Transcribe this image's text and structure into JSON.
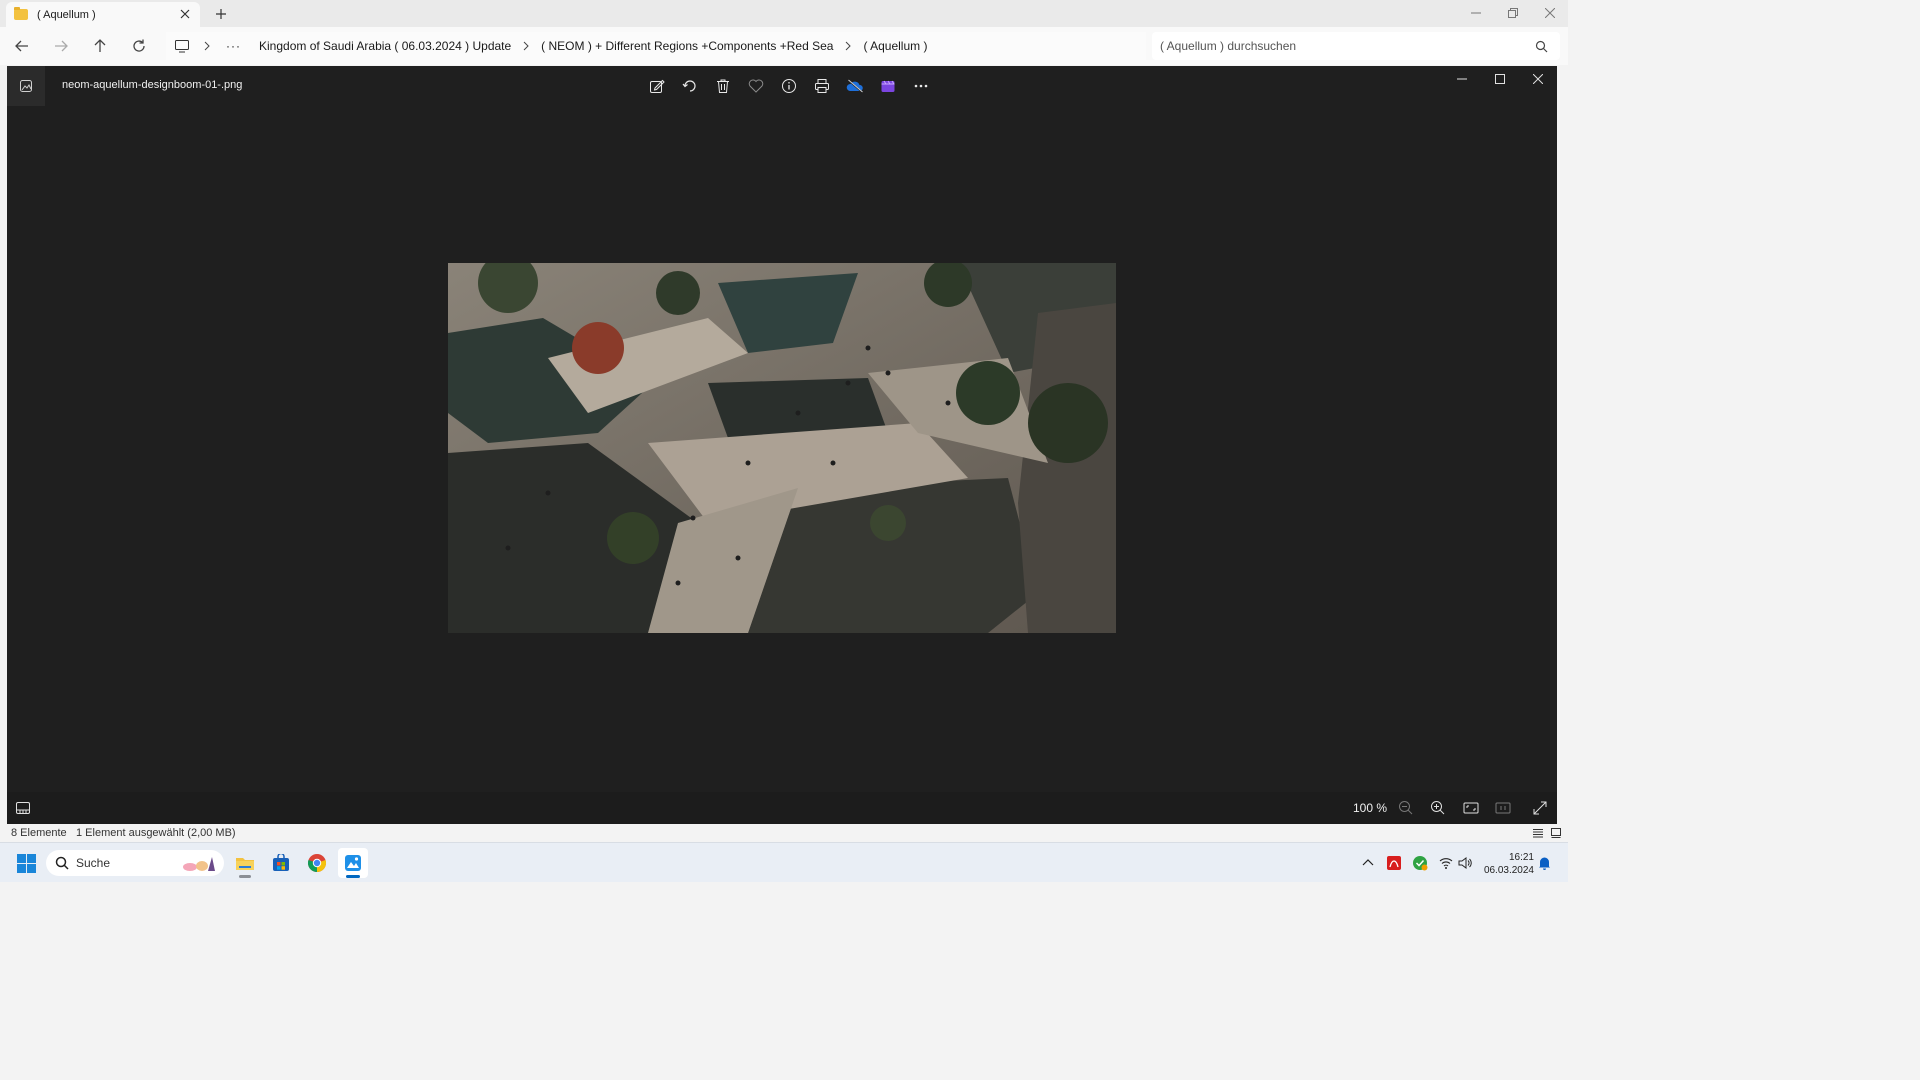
{
  "explorer": {
    "tab_title": "( Aquellum )",
    "breadcrumb": [
      "Kingdom of Saudi Arabia ( 06.03.2024 ) Update",
      "( NEOM ) + Different Regions +Components +Red Sea",
      "( Aquellum )"
    ],
    "search_placeholder": "( Aquellum ) durchsuchen",
    "status_count": "8 Elemente",
    "status_selection": "1 Element ausgewählt (2,00 MB)"
  },
  "viewer": {
    "file_name": "neom-aquellum-designboom-01-.png",
    "zoom_level": "100 %",
    "toolbar_icons": [
      "edit-icon",
      "rotate-icon",
      "delete-icon",
      "favorite-icon",
      "info-icon",
      "print-icon",
      "onedrive-icon",
      "clipchamp-icon",
      "more-icon"
    ],
    "image_description_icon": "photo"
  },
  "taskbar": {
    "search_label": "Suche",
    "time": "16:21",
    "date": "06.03.2024"
  },
  "colors": {
    "viewer_bg": "#1f1f1f",
    "accent": "#0067c0",
    "folder": "#f3c240"
  }
}
